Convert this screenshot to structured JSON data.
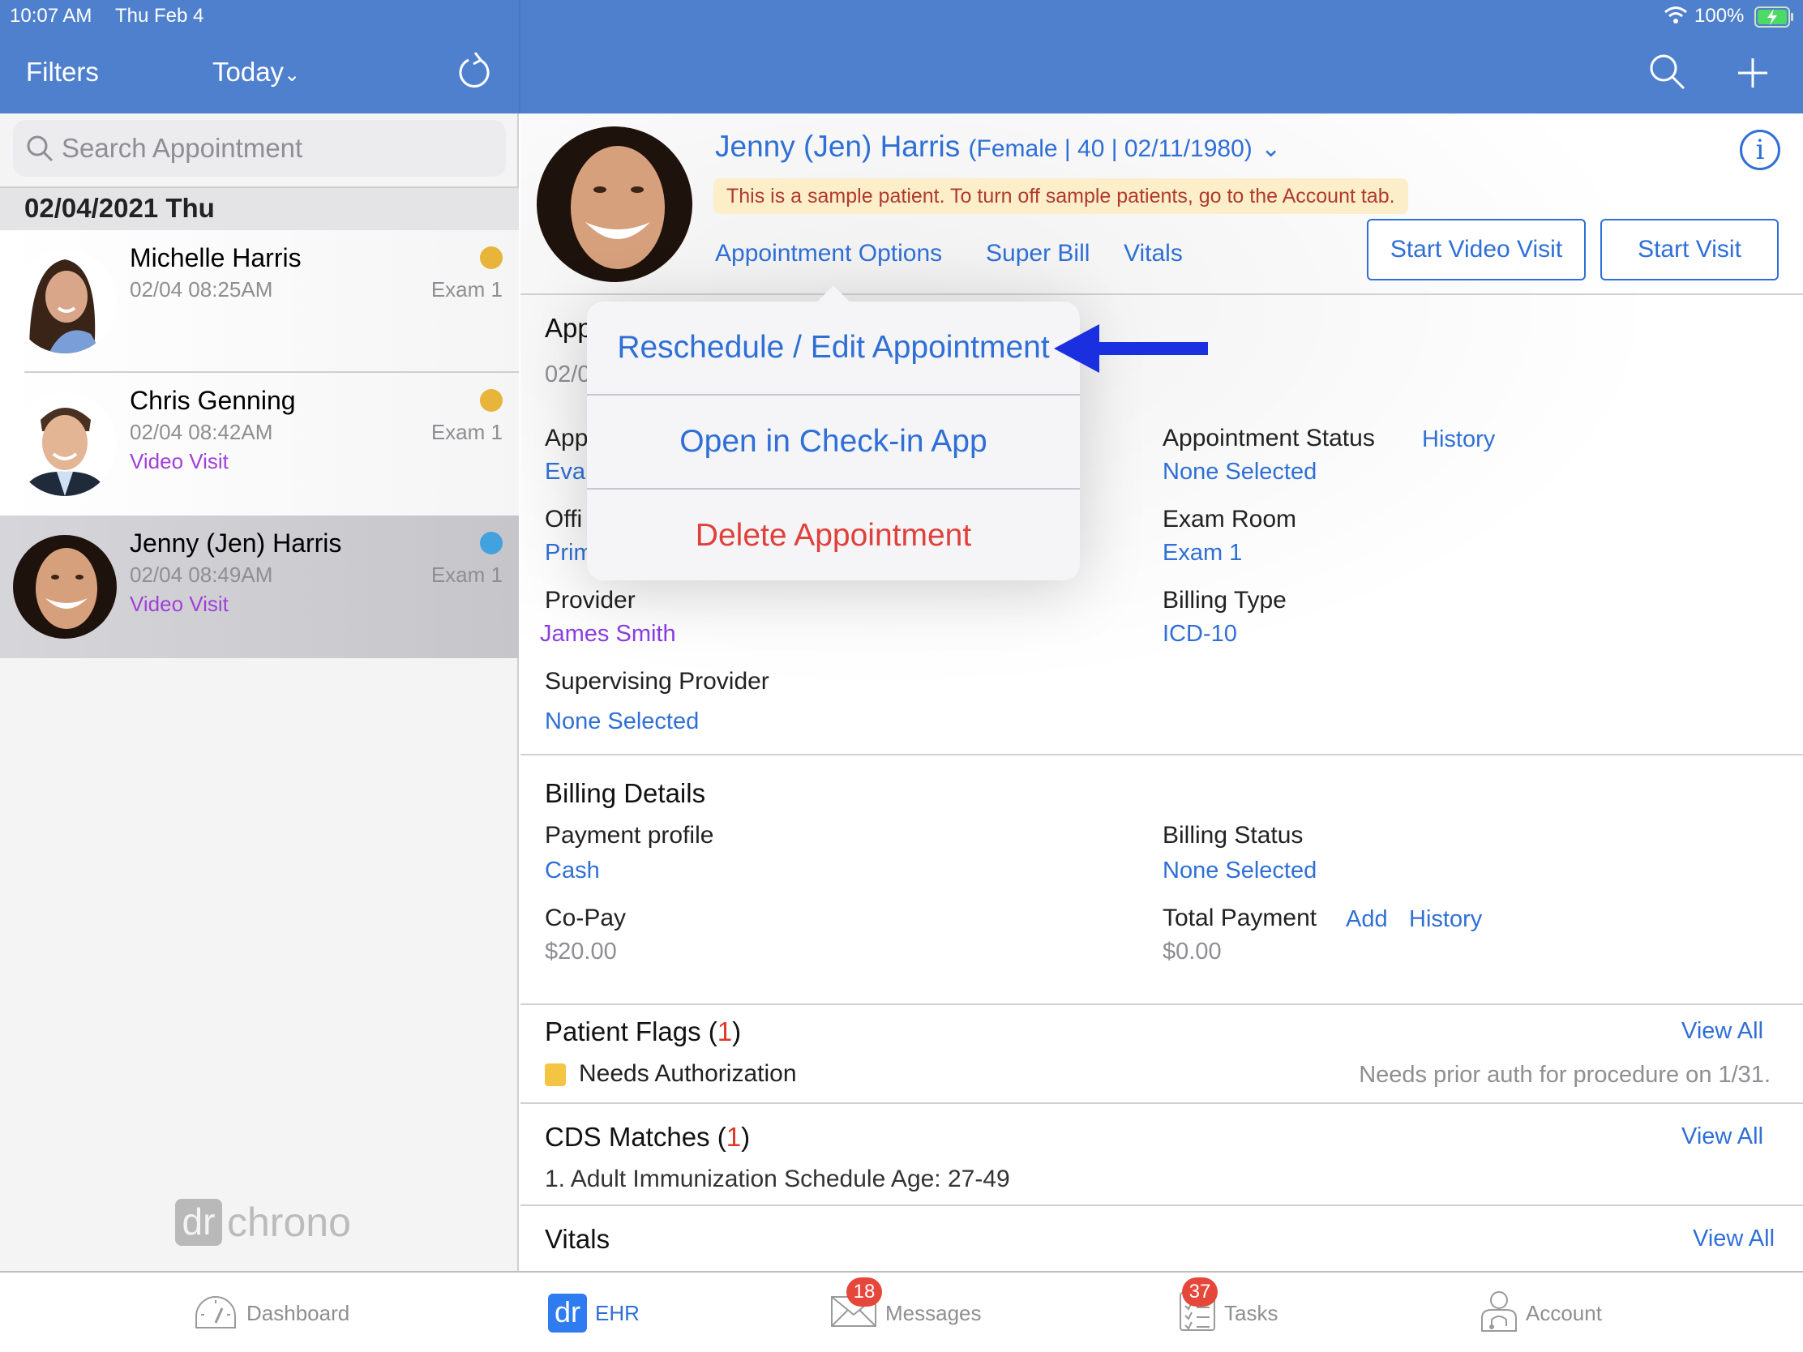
{
  "status_bar": {
    "time": "10:07 AM",
    "date": "Thu Feb 4",
    "battery": "100%"
  },
  "nav": {
    "filters_label": "Filters",
    "range_label": "Today",
    "range_chevron": "⌄"
  },
  "sidebar": {
    "search_placeholder": "Search Appointment",
    "date_header": "02/04/2021 Thu",
    "appointments": [
      {
        "name": "Michelle Harris",
        "time": "02/04 08:25AM",
        "room": "Exam 1",
        "type": "",
        "status_color": "#e8b43a"
      },
      {
        "name": "Chris Genning",
        "time": "02/04 08:42AM",
        "room": "Exam 1",
        "type": "Video Visit",
        "status_color": "#e8b43a"
      },
      {
        "name": "Jenny (Jen) Harris",
        "time": "02/04 08:49AM",
        "room": "Exam 1",
        "type": "Video Visit",
        "status_color": "#42a2e0",
        "selected": true
      }
    ],
    "logo": {
      "mark": "dr",
      "text": "chrono"
    }
  },
  "patient": {
    "name": "Jenny (Jen) Harris",
    "meta": "(Female | 40 | 02/11/1980)",
    "chevron": "⌄",
    "sample_banner": "This is a sample patient. To turn off sample patients, go to the Account tab.",
    "links": {
      "appointment_options": "Appointment Options",
      "super_bill": "Super Bill",
      "vitals": "Vitals"
    },
    "buttons": {
      "start_video_visit": "Start Video Visit",
      "start_visit": "Start Visit"
    }
  },
  "appointment": {
    "title_partial": "App",
    "date_partial": "02/0",
    "left": [
      {
        "label_partial": "App",
        "value_partial": "Eval"
      },
      {
        "label_partial": "Offi",
        "value_partial": "Prim"
      }
    ],
    "provider": {
      "label": "Provider",
      "value": "James Smith"
    },
    "supervising_provider": {
      "label": "Supervising Provider",
      "value": "None Selected"
    },
    "status": {
      "label": "Appointment Status",
      "history": "History",
      "value": "None Selected"
    },
    "exam_room": {
      "label": "Exam Room",
      "value": "Exam 1"
    },
    "billing_type": {
      "label": "Billing Type",
      "value": "ICD-10"
    }
  },
  "popover": {
    "items": [
      {
        "label": "Reschedule / Edit Appointment"
      },
      {
        "label": "Open in Check-in App"
      },
      {
        "label": "Delete Appointment",
        "destructive": true
      }
    ]
  },
  "billing": {
    "title": "Billing Details",
    "payment_profile": {
      "label": "Payment profile",
      "value": "Cash"
    },
    "billing_status": {
      "label": "Billing Status",
      "value": "None Selected"
    },
    "copay": {
      "label": "Co-Pay",
      "value": "$20.00"
    },
    "total_payment": {
      "label": "Total Payment",
      "add": "Add",
      "history": "History",
      "value": "$0.00"
    }
  },
  "patient_flags": {
    "title": "Patient Flags (",
    "count": "1",
    "close": ")",
    "view_all": "View All",
    "items": [
      {
        "name": "Needs Authorization",
        "note": "Needs prior auth for procedure on 1/31.",
        "color": "#f4c542"
      }
    ]
  },
  "cds_matches": {
    "title": "CDS Matches (",
    "count": "1",
    "close": ")",
    "view_all": "View All",
    "items": [
      "1. Adult Immunization Schedule Age: 27-49"
    ]
  },
  "vitals": {
    "title": "Vitals",
    "view_all": "View All"
  },
  "tabbar": {
    "tabs": [
      {
        "label": "Dashboard",
        "icon": "dashboard-gauge-icon"
      },
      {
        "label": "EHR",
        "icon": "ehr-dr-icon",
        "active": true,
        "mark": "dr"
      },
      {
        "label": "Messages",
        "icon": "envelope-icon",
        "badge": "18"
      },
      {
        "label": "Tasks",
        "icon": "checklist-icon",
        "badge": "37"
      },
      {
        "label": "Account",
        "icon": "doctor-account-icon"
      }
    ]
  }
}
